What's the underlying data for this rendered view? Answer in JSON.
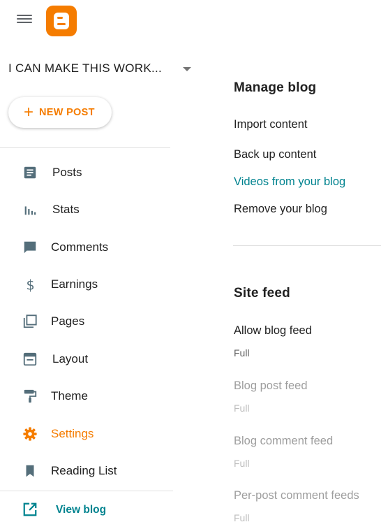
{
  "app": {
    "brand_color": "#f57c00",
    "link_color": "#00838f"
  },
  "header": {
    "menu_icon": "hamburger-menu-icon",
    "logo_icon": "blogger-logo-icon"
  },
  "blog_selector": {
    "title": "I CAN MAKE THIS WORK..."
  },
  "new_post": {
    "label": "NEW POST"
  },
  "sidebar": {
    "items": [
      {
        "label": "Posts",
        "icon": "posts-icon"
      },
      {
        "label": "Stats",
        "icon": "stats-icon"
      },
      {
        "label": "Comments",
        "icon": "comments-icon"
      },
      {
        "label": "Earnings",
        "icon": "dollar-icon"
      },
      {
        "label": "Pages",
        "icon": "pages-icon"
      },
      {
        "label": "Layout",
        "icon": "layout-icon"
      },
      {
        "label": "Theme",
        "icon": "paint-roller-icon"
      },
      {
        "label": "Settings",
        "icon": "gear-icon",
        "active": true
      },
      {
        "label": "Reading List",
        "icon": "bookmark-icon"
      }
    ],
    "view_blog": {
      "label": "View blog",
      "icon": "open-in-new-icon"
    }
  },
  "main": {
    "manage_blog": {
      "title": "Manage blog",
      "items": [
        "Import content",
        "Back up content",
        "Videos from your blog",
        "Remove your blog"
      ]
    },
    "site_feed": {
      "title": "Site feed",
      "settings": [
        {
          "label": "Allow blog feed",
          "value": "Full",
          "enabled": true
        },
        {
          "label": "Blog post feed",
          "value": "Full",
          "enabled": false
        },
        {
          "label": "Blog comment feed",
          "value": "Full",
          "enabled": false
        },
        {
          "label": "Per-post comment feeds",
          "value": "Full",
          "enabled": false
        }
      ]
    }
  }
}
